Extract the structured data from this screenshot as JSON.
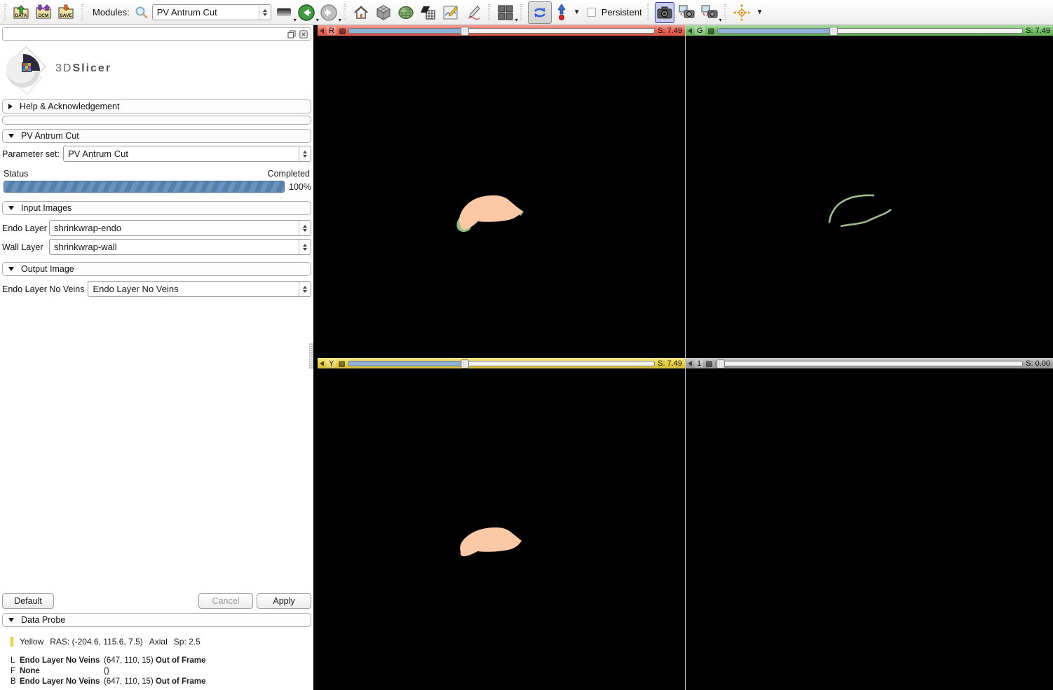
{
  "toolbar": {
    "modules_label": "Modules:",
    "modules_value": "PV Antrum Cut",
    "persistent_label": "Persistent",
    "icon_names": [
      "load-data-folder",
      "dicom-folder",
      "save-folder",
      "search",
      "module-panel",
      "history-back",
      "history-forward",
      "home",
      "cube",
      "extensions-sphere",
      "mesh-ruler",
      "chart-edit",
      "markup-pencil",
      "layout-grid",
      "rotate-mode",
      "place-fiducial",
      "screenshot",
      "scene-view",
      "scene-view-add",
      "crosshair"
    ],
    "folder_labels": {
      "data": "DATA",
      "dcm": "DCM",
      "save": "SAVE"
    }
  },
  "panel": {
    "logo": {
      "part1": "3D",
      "part2": "Slicer"
    },
    "sections": {
      "help": "Help & Acknowledgement",
      "module": "PV Antrum Cut",
      "input_images": "Input Images",
      "output_image": "Output Image",
      "data_probe": "Data Probe"
    },
    "parameter_set": {
      "label": "Parameter set:",
      "value": "PV Antrum Cut"
    },
    "status": {
      "label": "Status",
      "state": "Completed",
      "percent": "100%",
      "value": 100
    },
    "inputs": [
      {
        "label": "Endo Layer",
        "value": "shrinkwrap-endo"
      },
      {
        "label": "Wall Layer",
        "value": "shrinkwrap-wall"
      }
    ],
    "output": {
      "label": "Endo Layer No Veins",
      "value": "Endo Layer No Veins"
    },
    "buttons": {
      "default": "Default",
      "cancel": "Cancel",
      "apply": "Apply"
    },
    "data_probe": {
      "slice": {
        "name": "Yellow",
        "ras": "RAS: (-204.6, 115.6, 7.5)",
        "orientation": "Axial",
        "spacing": "Sp: 2.5"
      },
      "rows": [
        {
          "letter": "L",
          "name": "Endo Layer No Veins",
          "coords": "(647, 110, 15)",
          "status": "Out of Frame"
        },
        {
          "letter": "F",
          "name": "None",
          "coords": "()",
          "status": ""
        },
        {
          "letter": "B",
          "name": "Endo Layer No Veins",
          "coords": "(647, 110, 15)",
          "status": "Out of Frame"
        }
      ]
    }
  },
  "viewports": {
    "red": {
      "label": "R",
      "value": "S: 7.49",
      "handle_pct": 38
    },
    "green": {
      "label": "G",
      "value": "S: 7.49",
      "handle_pct": 38
    },
    "yellow": {
      "label": "Y",
      "value": "S: 7.49",
      "handle_pct": 38
    },
    "gray": {
      "label": "1",
      "value": "S: 0.00",
      "handle_pct": 1.5
    }
  },
  "colors": {
    "red_bar": "#ee6352",
    "green_bar": "#74c266",
    "yellow_bar": "#eed53d",
    "gray_bar": "#ababab",
    "slider_fill": "#8fb2d9",
    "blob_salmon": "#fbc9a6",
    "blob_green": "#8fba80",
    "curve_green": "#9cbd8c",
    "probe_swatch": "#e8d33c"
  }
}
